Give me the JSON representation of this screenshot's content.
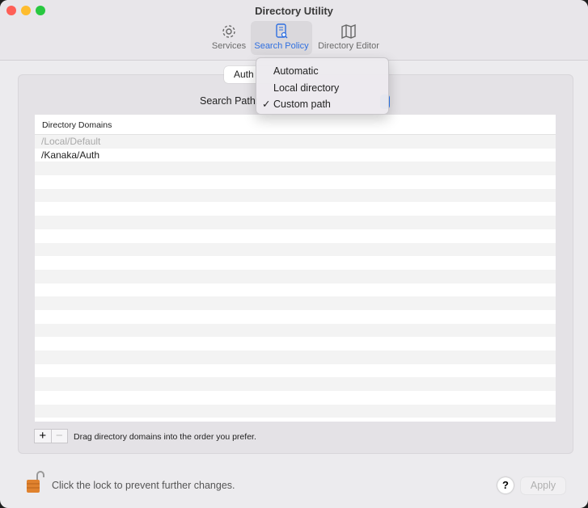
{
  "window": {
    "title": "Directory Utility"
  },
  "toolbar": {
    "items": [
      {
        "label": "Services",
        "icon": "gear-icon"
      },
      {
        "label": "Search Policy",
        "icon": "search-policy-icon",
        "selected": true
      },
      {
        "label": "Directory Editor",
        "icon": "map-icon"
      }
    ]
  },
  "segmented": {
    "visible_label": "Auth"
  },
  "search_path": {
    "label": "Search Path:",
    "menu": [
      {
        "label": "Automatic",
        "checked": false
      },
      {
        "label": "Local directory",
        "checked": false
      },
      {
        "label": "Custom path",
        "checked": true
      }
    ],
    "check": "✓"
  },
  "table": {
    "header": "Directory Domains",
    "rows": [
      "/Local/Default",
      "/Kanaka/Auth"
    ]
  },
  "buttons": {
    "add": "+",
    "remove": "−",
    "help": "?",
    "apply": "Apply"
  },
  "hint": "Drag directory domains into the order you prefer.",
  "lock_text": "Click the lock to prevent further changes.",
  "colors": {
    "accent": "#2f7bf5"
  }
}
